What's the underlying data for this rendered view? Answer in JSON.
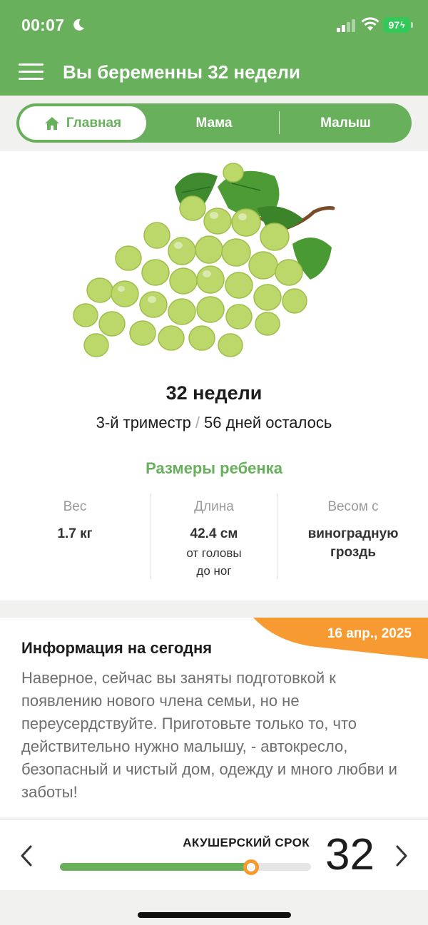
{
  "status_bar": {
    "time": "00:07",
    "battery": "97",
    "icons": [
      "moon-icon",
      "signal-icon",
      "wifi-icon",
      "battery-icon"
    ]
  },
  "header": {
    "title": "Вы беременны 32 недели",
    "menu_icon": "hamburger-menu-icon"
  },
  "tabs": [
    {
      "label": "Главная",
      "icon": "home-icon",
      "active": true
    },
    {
      "label": "Мама",
      "active": false
    },
    {
      "label": "Малыш",
      "active": false
    }
  ],
  "week_info": {
    "title": "32 недели",
    "trimester": "3-й триместр",
    "separator": "/",
    "days_left": "56 дней осталось"
  },
  "baby_size": {
    "title": "Размеры ребенка",
    "weight": {
      "header": "Вес",
      "value": "1.7 кг"
    },
    "length": {
      "header": "Длина",
      "value": "42.4 см",
      "note_line1": "от головы",
      "note_line2": "до ног"
    },
    "compare": {
      "header": "Весом с",
      "value_line1": "виноградную",
      "value_line2": "гроздь"
    }
  },
  "today_info": {
    "date": "16 апр., 2025",
    "title": "Информация на сегодня",
    "text": "Наверное, сейчас вы заняты подготовкой к появлению нового члена семьи, но не переусердствуйте. Приготовьте только то, что действительно нужно малышу, - автокресло, безопасный и чистый дом, одежду и много любви и заботы!"
  },
  "term_slider": {
    "label": "АКУШЕРСКИЙ СРОК",
    "week": "32",
    "progress": 0.76
  },
  "colors": {
    "brand_green": "#68b05c",
    "accent_orange": "#f59a2e",
    "body_text_gray": "#6e6e6e"
  }
}
